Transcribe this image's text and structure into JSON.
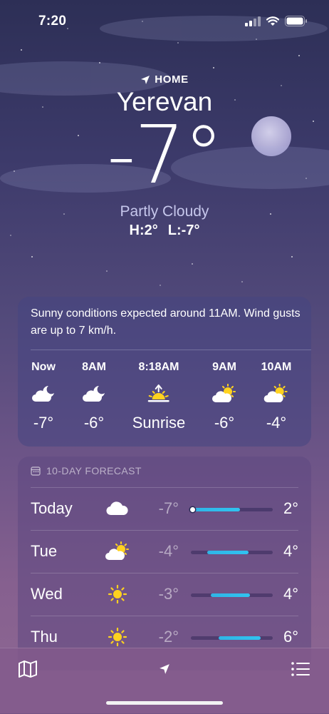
{
  "status_bar": {
    "time": "7:20"
  },
  "header": {
    "location_label": "HOME",
    "city": "Yerevan",
    "temperature": "-7°",
    "condition": "Partly Cloudy",
    "high": "H:2°",
    "low": "L:-7°"
  },
  "hourly": {
    "summary": "Sunny conditions expected around 11AM. Wind gusts are up to 7 km/h.",
    "items": [
      {
        "time": "Now",
        "icon": "moon-cloud-icon",
        "temp": "-7°"
      },
      {
        "time": "8AM",
        "icon": "moon-cloud-icon",
        "temp": "-6°"
      },
      {
        "time": "8:18AM",
        "icon": "sunrise-icon",
        "temp": "Sunrise"
      },
      {
        "time": "9AM",
        "icon": "sun-cloud-icon",
        "temp": "-6°"
      },
      {
        "time": "10AM",
        "icon": "sun-cloud-icon",
        "temp": "-4°"
      }
    ]
  },
  "forecast": {
    "title": "10-DAY FORECAST",
    "days": [
      {
        "day": "Today",
        "icon": "cloud-icon",
        "low": "-7°",
        "high": "2°",
        "range_start": 0.0,
        "range_end": 0.6,
        "current_marker": 0.0
      },
      {
        "day": "Tue",
        "icon": "sun-cloud-icon",
        "low": "-4°",
        "high": "4°",
        "range_start": 0.2,
        "range_end": 0.7
      },
      {
        "day": "Wed",
        "icon": "sun-icon",
        "low": "-3°",
        "high": "4°",
        "range_start": 0.24,
        "range_end": 0.72
      },
      {
        "day": "Thu",
        "icon": "sun-icon",
        "low": "-2°",
        "high": "6°",
        "range_start": 0.34,
        "range_end": 0.85
      }
    ]
  },
  "colors": {
    "accent_bar": "#30c3f0",
    "sun": "#ffd21f",
    "condition_text": "#c6c7ec"
  }
}
